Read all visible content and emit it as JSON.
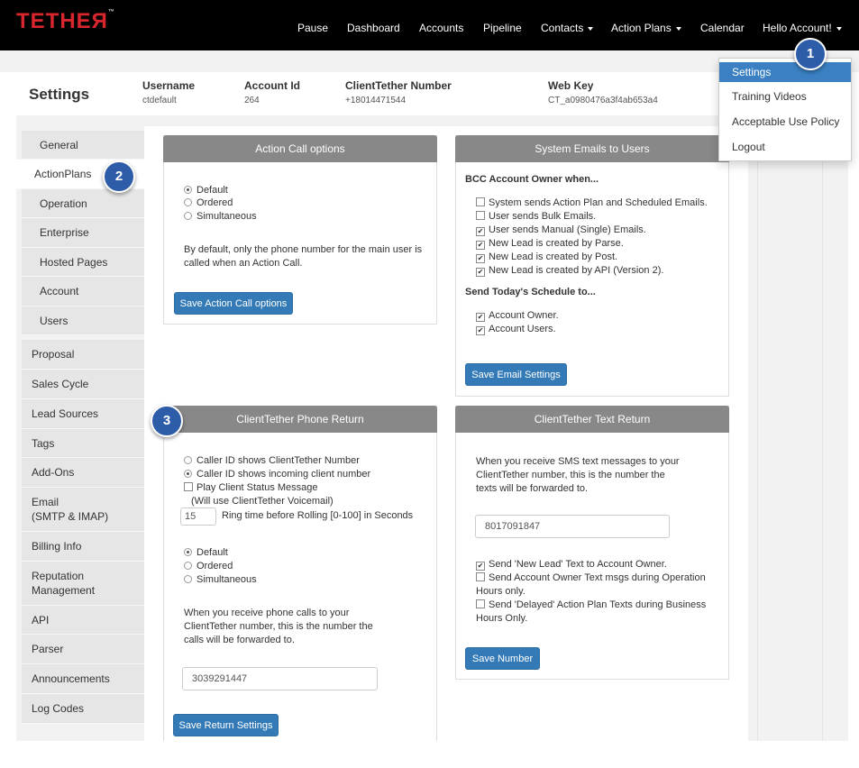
{
  "nav": {
    "logo": "TETHEЯ",
    "logo_tm": "™",
    "items": [
      "Pause",
      "Dashboard",
      "Accounts",
      "Pipeline",
      "Contacts",
      "Action Plans",
      "Calendar",
      "Hello Account!"
    ]
  },
  "header": {
    "title": "Settings",
    "username_label": "Username",
    "username": "ctdefault",
    "account_id_label": "Account Id",
    "account_id": "264",
    "ct_number_label": "ClientTether Number",
    "ct_number": "+18014471544",
    "web_key_label": "Web Key",
    "web_key": "CT_a0980476a3f4ab653a4"
  },
  "dropdown": {
    "items": [
      "Settings",
      "Training Videos",
      "Acceptable Use Policy",
      "Logout"
    ],
    "selected": "Settings"
  },
  "sidebar": {
    "items": [
      "General",
      "ActionPlans",
      "Operation",
      "Enterprise",
      "Hosted Pages",
      "Account",
      "Users",
      "Proposal",
      "Sales Cycle",
      "Lead Sources",
      "Tags",
      "Add-Ons",
      "Email\n(SMTP & IMAP)",
      "Billing Info",
      "Reputation\nManagement",
      "API",
      "Parser",
      "Announcements",
      "Log Codes"
    ],
    "active": "ActionPlans"
  },
  "action_call": {
    "title": "Action Call options",
    "options": [
      "Default",
      "Ordered",
      "Simultaneous"
    ],
    "selected": "Default",
    "desc_line1": "By default, only the phone number for the main user is",
    "desc_line2": "called when an Action Call.",
    "save_label": "Save Action Call options"
  },
  "system_emails": {
    "title": "System Emails to Users",
    "bcc_heading": "BCC Account Owner when...",
    "bcc_items": [
      {
        "label": "System sends Action Plan and Scheduled Emails.",
        "checked": false
      },
      {
        "label": "User sends Bulk Emails.",
        "checked": false
      },
      {
        "label": "User sends Manual (Single) Emails.",
        "checked": true
      },
      {
        "label": "New Lead is created by Parse.",
        "checked": true
      },
      {
        "label": "New Lead is created by Post.",
        "checked": true
      },
      {
        "label": "New Lead is created by API (Version 2).",
        "checked": true
      }
    ],
    "schedule_heading": "Send Today's Schedule to...",
    "schedule_items": [
      {
        "label": "Account Owner.",
        "checked": true
      },
      {
        "label": "Account Users.",
        "checked": true
      }
    ],
    "save_label": "Save Email Settings"
  },
  "phone_return": {
    "title": "ClientTether Phone Return",
    "caller_options": [
      "Caller ID shows ClientTether Number",
      "Caller ID shows incoming client number"
    ],
    "caller_selected": 1,
    "status_label": "Play Client Status Message",
    "status_checked": false,
    "voicemail_note": "(Will use ClientTether Voicemail)",
    "ring_value": "15",
    "ring_label": "Ring time before Rolling [0-100] in Seconds",
    "order_options": [
      "Default",
      "Ordered",
      "Simultaneous"
    ],
    "order_selected": "Default",
    "desc_line1": "When you receive phone calls to your",
    "desc_line2": "ClientTether number, this is the number the",
    "desc_line3": "calls will be forwarded to.",
    "forward_number": "3039291447",
    "save_label": "Save Return Settings"
  },
  "text_return": {
    "title": "ClientTether Text Return",
    "desc_line1": "When you receive SMS text messages to your",
    "desc_line2": "ClientTether number, this is the number the",
    "desc_line3": "texts will be forwarded to.",
    "forward_number": "8017091847",
    "opt1": "Send 'New Lead' Text to Account Owner.",
    "opt1_checked": true,
    "opt2_line1": "Send Account Owner Text msgs during Operation",
    "opt2_line2": "Hours only.",
    "opt2_checked": false,
    "opt3_line1": "Send 'Delayed' Action Plan Texts during Business",
    "opt3_line2": "Hours Only.",
    "opt3_checked": false,
    "save_label": "Save Number"
  },
  "callouts": [
    "1",
    "2",
    "3"
  ],
  "colors": {
    "accent": "#337ab7",
    "badge": "#2d5ca8",
    "logo": "#d7262e",
    "panel_header": "#888888",
    "selected_menu": "#3a80c2"
  }
}
